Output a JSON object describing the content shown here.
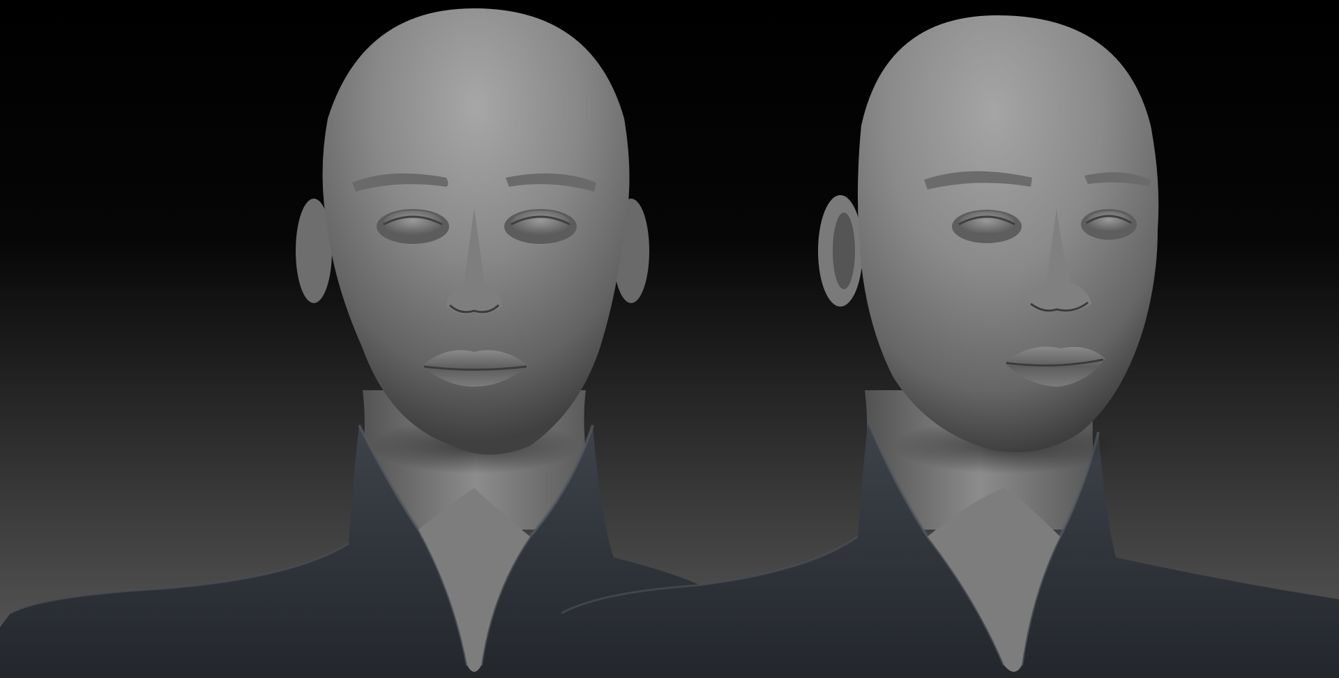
{
  "scene": {
    "colors": {
      "background_top": "#000000",
      "background_bottom": "#5a5a5a",
      "skin_light": "#a8a8a8",
      "skin_mid": "#7a7a7a",
      "skin_dark": "#3e3e3e",
      "garment": "#2d3136",
      "garment_highlight": "#4c5158"
    },
    "views": [
      {
        "label": "front-view"
      },
      {
        "label": "three-quarter-view"
      }
    ]
  }
}
